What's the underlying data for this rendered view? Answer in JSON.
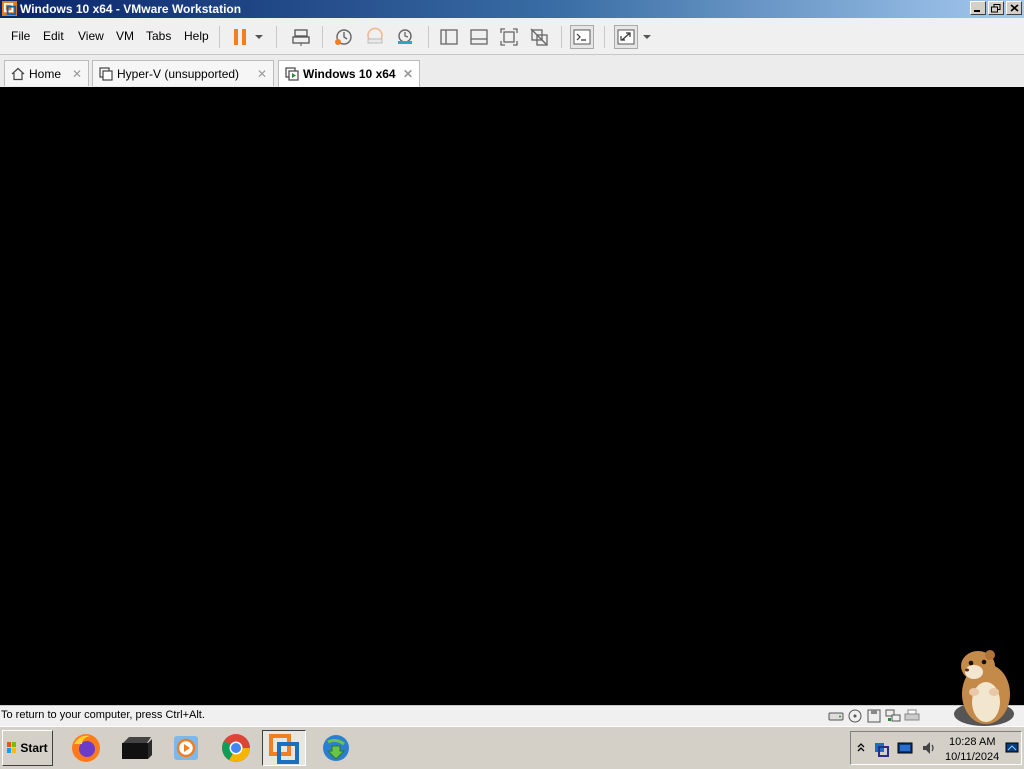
{
  "window": {
    "title": "Windows 10 x64 - VMware Workstation",
    "controls": [
      "minimize",
      "restore",
      "close"
    ]
  },
  "menu": {
    "items": [
      "File",
      "Edit",
      "View",
      "VM",
      "Tabs",
      "Help"
    ]
  },
  "toolbar": {
    "icons": [
      "pause-icon",
      "dropdown-arrow-icon",
      "send-ctrl-alt-del-icon",
      "snapshot-icon",
      "revert-snapshot-icon",
      "snapshot-manager-icon",
      "show-library-icon",
      "thumbnail-bar-icon",
      "full-screen-icon",
      "unity-icon",
      "console-view-icon",
      "stretch-guest-icon",
      "stretch-dropdown-icon"
    ]
  },
  "tabs": [
    {
      "label": "Home",
      "icon": "home-icon",
      "active": false
    },
    {
      "label": "Hyper-V (unsupported)",
      "icon": "vm-icon",
      "active": false
    },
    {
      "label": "Windows 10 x64",
      "icon": "vm-running-icon",
      "active": true
    }
  ],
  "status": {
    "message": "To return to your computer, press Ctrl+Alt.",
    "device_icons": [
      "hard-disk-icon",
      "cd-dvd-icon",
      "floppy-icon",
      "network-icon",
      "printer-icon"
    ]
  },
  "taskbar": {
    "start_label": "Start",
    "apps": [
      "firefox-icon",
      "terminal-icon",
      "media-player-icon",
      "chrome-icon",
      "vmware-icon",
      "internet-download-manager-icon"
    ],
    "clock_time": "10:28 AM",
    "clock_date": "10/11/2024"
  },
  "colors": {
    "title_gradient_start": "#0a246a",
    "title_gradient_end": "#a6caf0",
    "pause_orange": "#f07e22",
    "vm_screen": "#000000"
  }
}
